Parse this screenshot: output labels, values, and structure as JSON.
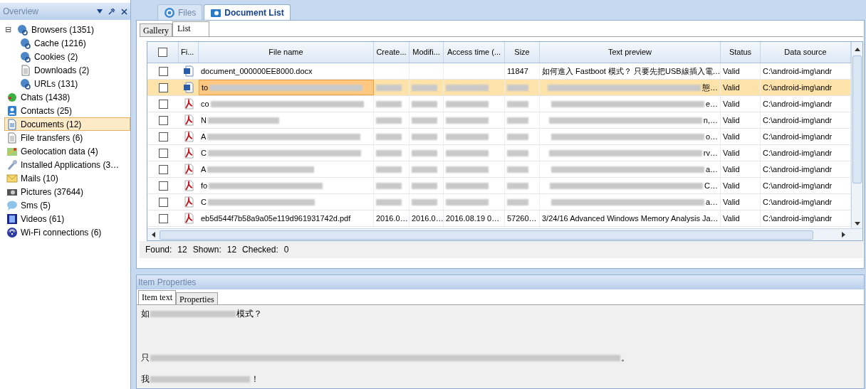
{
  "overview": {
    "title": "Overview",
    "items": [
      {
        "label": "Browsers (1351)",
        "kind": "globe",
        "selected": false,
        "toggle": "⊟",
        "children": [
          {
            "label": "Cache (1216)",
            "kind": "globe",
            "selected": false
          },
          {
            "label": "Cookies (2)",
            "kind": "globe",
            "selected": false
          },
          {
            "label": "Downloads (2)",
            "kind": "page",
            "selected": false
          },
          {
            "label": "URLs (131)",
            "kind": "globe",
            "selected": false
          }
        ]
      },
      {
        "label": "Chats (1438)",
        "kind": "chat",
        "selected": false
      },
      {
        "label": "Contacts (25)",
        "kind": "contact",
        "selected": false
      },
      {
        "label": "Documents (12)",
        "kind": "doc",
        "selected": true
      },
      {
        "label": "File transfers (6)",
        "kind": "page",
        "selected": false
      },
      {
        "label": "Geolocation data (4)",
        "kind": "map",
        "selected": false
      },
      {
        "label": "Installed Applications (3…",
        "kind": "wrench",
        "selected": false
      },
      {
        "label": "Mails (10)",
        "kind": "mail",
        "selected": false
      },
      {
        "label": "Pictures (37644)",
        "kind": "camera",
        "selected": false
      },
      {
        "label": "Sms (5)",
        "kind": "bubble",
        "selected": false
      },
      {
        "label": "Videos (61)",
        "kind": "film",
        "selected": false
      },
      {
        "label": "Wi-Fi connections (6)",
        "kind": "wifi",
        "selected": false
      }
    ]
  },
  "doc_tabs": [
    {
      "label": "Files",
      "selected": false
    },
    {
      "label": "Document List",
      "selected": true
    }
  ],
  "view_tabs": [
    {
      "label": "Gallery",
      "selected": false
    },
    {
      "label": "List",
      "selected": true
    }
  ],
  "table": {
    "all_checked": false,
    "columns": [
      "Fi...",
      "File name",
      "Create...",
      "Modifi...",
      "Access time (...",
      "Size",
      "Text preview",
      "Status",
      "Data source"
    ],
    "rows": [
      {
        "selected": false,
        "checked": false,
        "kind": "word",
        "redacted": false,
        "name": "document_000000EE8000.docx",
        "size": "11847",
        "preview": "如何進入 Fastboot 模式？ 只要先把USB線插入電…",
        "status": "Valid",
        "data_source": "C:\\android-img\\andr"
      },
      {
        "selected": true,
        "checked": false,
        "kind": "word",
        "redacted": true,
        "name": "to",
        "preview": "態…",
        "status": "Valid",
        "data_source": "C:\\android-img\\andr"
      },
      {
        "selected": false,
        "checked": false,
        "kind": "pdf",
        "redacted": true,
        "name": "co",
        "preview": "e…",
        "status": "Valid",
        "data_source": "C:\\android-img\\andr"
      },
      {
        "selected": false,
        "checked": false,
        "kind": "pdf",
        "redacted": true,
        "name": "N",
        "preview": "n,…",
        "status": "Valid",
        "data_source": "C:\\android-img\\andr"
      },
      {
        "selected": false,
        "checked": false,
        "kind": "pdf",
        "redacted": true,
        "name": "A",
        "preview": "o…",
        "status": "Valid",
        "data_source": "C:\\android-img\\andr"
      },
      {
        "selected": false,
        "checked": false,
        "kind": "pdf",
        "redacted": true,
        "name": "C",
        "preview": "rv…",
        "status": "Valid",
        "data_source": "C:\\android-img\\andr"
      },
      {
        "selected": false,
        "checked": false,
        "kind": "pdf",
        "redacted": true,
        "name": "A",
        "preview": "a…",
        "status": "Valid",
        "data_source": "C:\\android-img\\andr"
      },
      {
        "selected": false,
        "checked": false,
        "kind": "pdf",
        "redacted": true,
        "name": "fo",
        "preview": "C…",
        "status": "Valid",
        "data_source": "C:\\android-img\\andr"
      },
      {
        "selected": false,
        "checked": false,
        "kind": "pdf",
        "redacted": true,
        "name": "C",
        "preview": "a…",
        "status": "Valid",
        "data_source": "C:\\android-img\\andr"
      },
      {
        "selected": false,
        "checked": false,
        "kind": "pdf",
        "redacted": false,
        "name": "eb5d544f7b58a9a05e119d961931742d.pdf",
        "created": "2016.0…",
        "modified": "2016.0…",
        "access_time": "2016.08.19 0…",
        "size": "57260…",
        "preview": "3/24/16 Advanced Windows Memory Analysis Ja…",
        "status": "Valid",
        "data_source": "C:\\android-img\\andr"
      }
    ]
  },
  "counts": [
    {
      "label": "Found:",
      "value": "12"
    },
    {
      "label": "Shown:",
      "value": "12"
    },
    {
      "label": "Checked:",
      "value": "0"
    }
  ],
  "properties": {
    "title": "Item Properties",
    "tabs": [
      {
        "label": "Item text",
        "selected": true
      },
      {
        "label": "Properties",
        "selected": false
      }
    ],
    "lines": [
      {
        "start": "如",
        "end": "模式？"
      },
      {
        "start": "只",
        "end": "。"
      },
      {
        "start": "我",
        "end": "！"
      }
    ]
  }
}
